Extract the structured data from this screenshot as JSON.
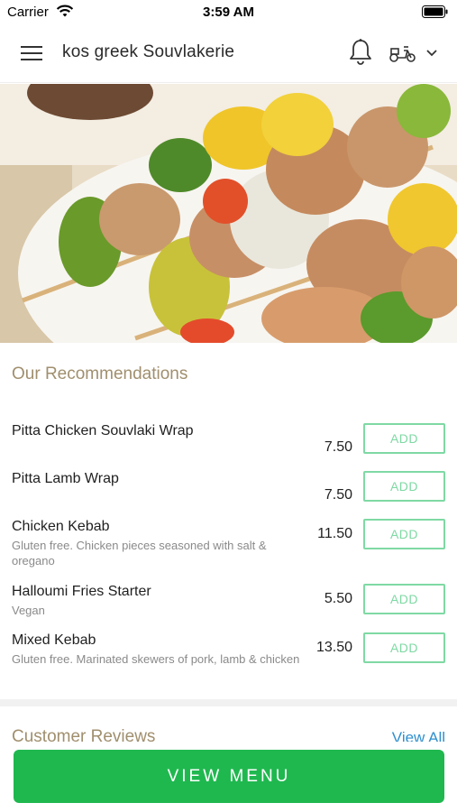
{
  "status_bar": {
    "carrier": "Carrier",
    "time": "3:59 AM",
    "wifi_icon": "wifi-icon",
    "battery_icon": "battery-icon"
  },
  "header": {
    "restaurant_name": "kos greek Souvlakerie",
    "menu_icon": "menu-icon",
    "notification_icon": "bell-icon",
    "delivery_icon": "scooter-icon",
    "dropdown_icon": "chevron-down-icon"
  },
  "hero": {
    "image_subject": "chicken souvlaki skewers with peppers and onions"
  },
  "recommendations": {
    "title": "Our Recommendations",
    "add_label": "ADD",
    "items": [
      {
        "name": "Pitta Chicken Souvlaki Wrap",
        "description": "",
        "price": "7.50"
      },
      {
        "name": "Pitta Lamb Wrap",
        "description": "",
        "price": "7.50"
      },
      {
        "name": "Chicken Kebab",
        "description": "Gluten free. Chicken pieces seasoned with salt & oregano",
        "price": "11.50"
      },
      {
        "name": "Halloumi Fries Starter",
        "description": "Vegan",
        "price": "5.50"
      },
      {
        "name": "Mixed Kebab",
        "description": "Gluten free. Marinated skewers of pork, lamb & chicken",
        "price": "13.50"
      }
    ]
  },
  "reviews": {
    "title": "Customer Reviews",
    "view_all_label": "View All"
  },
  "footer": {
    "view_menu_label": "VIEW MENU"
  },
  "colors": {
    "accent_green": "#1fb84f",
    "add_border": "#7fd9a4",
    "section_title": "#a08f6e",
    "link_blue": "#2f8fce"
  }
}
